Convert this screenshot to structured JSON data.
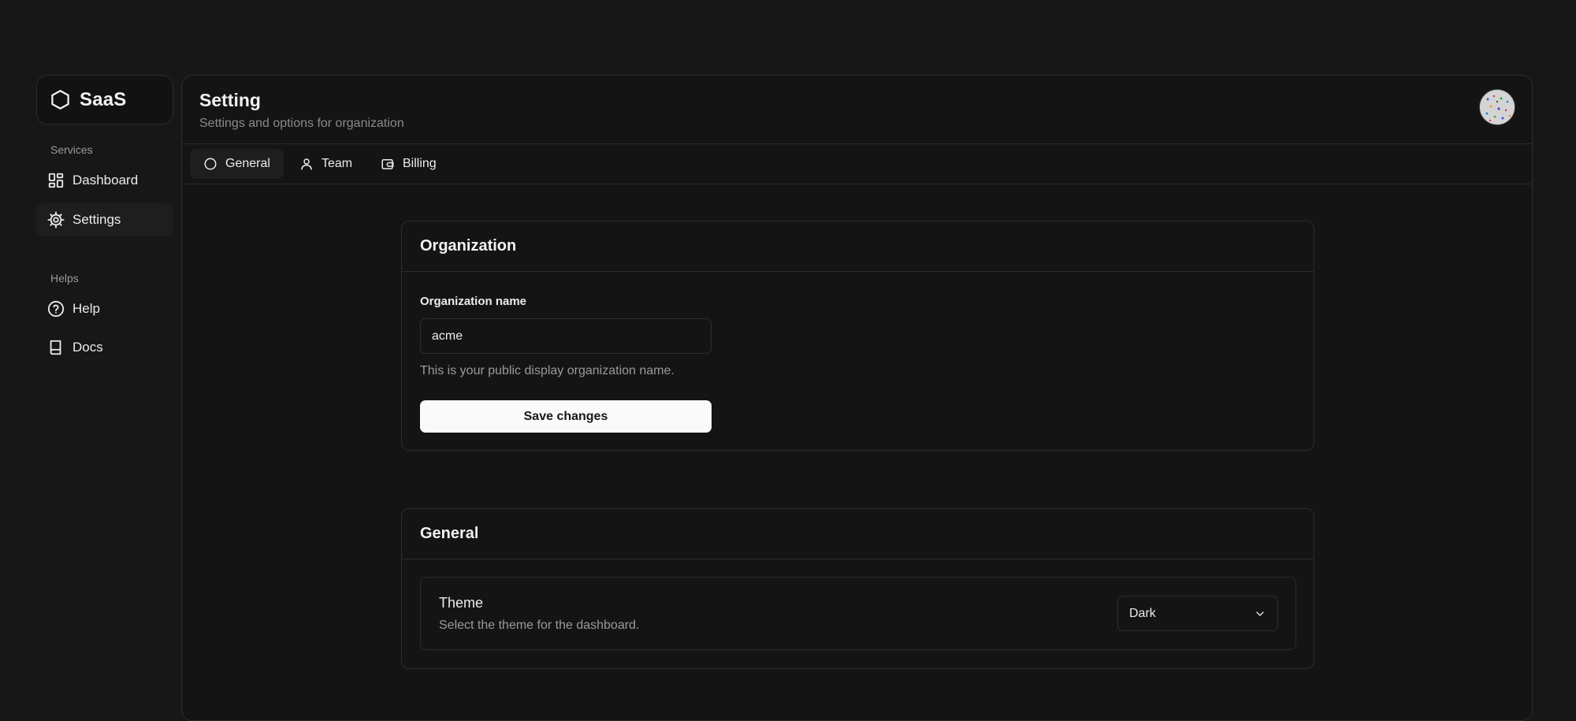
{
  "brand": {
    "name": "SaaS"
  },
  "sidebar": {
    "sections": [
      {
        "label": "Services",
        "items": [
          {
            "label": "Dashboard",
            "icon": "dashboard-icon"
          },
          {
            "label": "Settings",
            "icon": "gear-icon",
            "active": true
          }
        ]
      },
      {
        "label": "Helps",
        "items": [
          {
            "label": "Help",
            "icon": "help-circle-icon"
          },
          {
            "label": "Docs",
            "icon": "book-icon"
          }
        ]
      }
    ]
  },
  "header": {
    "title": "Setting",
    "subtitle": "Settings and options for organization"
  },
  "tabs": [
    {
      "label": "General",
      "icon": "circle-icon",
      "active": true
    },
    {
      "label": "Team",
      "icon": "user-icon"
    },
    {
      "label": "Billing",
      "icon": "wallet-icon"
    }
  ],
  "organization": {
    "title": "Organization",
    "name_label": "Organization name",
    "name_value": "acme",
    "name_help": "This is your public display organization name.",
    "save_label": "Save changes"
  },
  "general": {
    "title": "General",
    "theme_label": "Theme",
    "theme_description": "Select the theme for the dashboard.",
    "theme_value": "Dark"
  },
  "colors": {
    "background": "#171717",
    "panel": "#141414",
    "border": "#2c2c2c",
    "primary_button": "#fafafa"
  }
}
